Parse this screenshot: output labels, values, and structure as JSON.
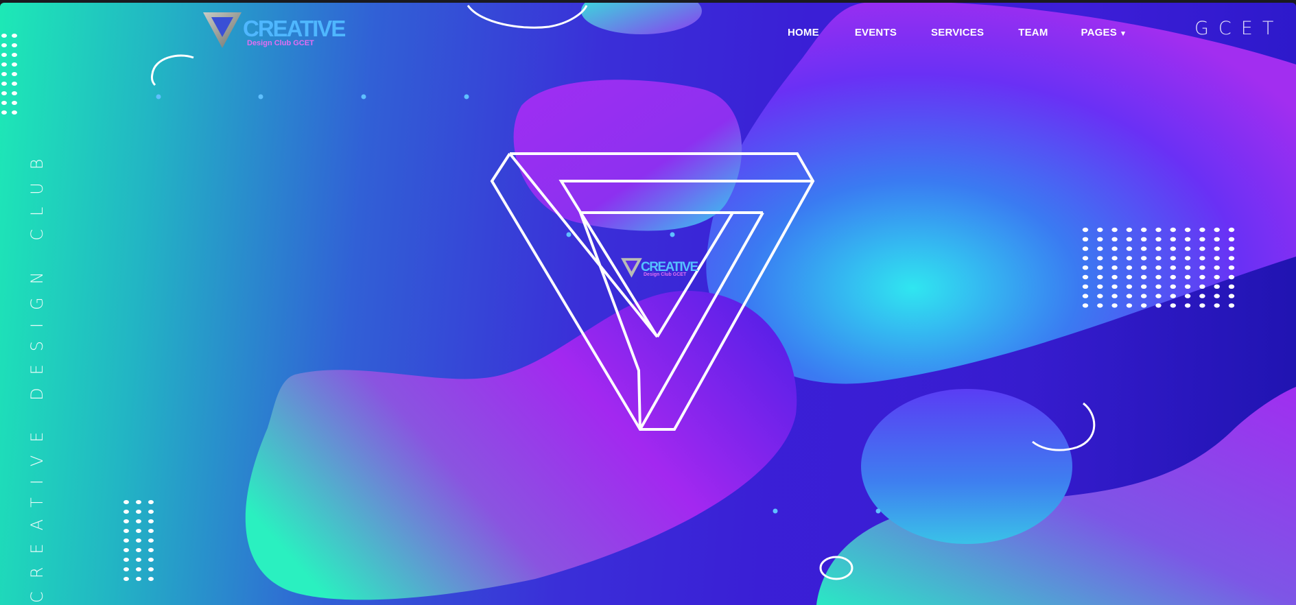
{
  "logo": {
    "word": "CREATIVE",
    "subtitle": "Design Club GCET"
  },
  "nav": {
    "items": [
      {
        "label": "HOME"
      },
      {
        "label": "EVENTS"
      },
      {
        "label": "SERVICES"
      },
      {
        "label": "TEAM"
      },
      {
        "label": "PAGES"
      }
    ],
    "pages_caret": "▾"
  },
  "brand_right": "GCET",
  "vertical_text": "CREATIVE DESIGN CLUB",
  "center_logo": {
    "word": "CREATIVE",
    "subtitle": "Design Club GCET"
  },
  "colors": {
    "teal": "#1de9b6",
    "blue": "#3a2fd8",
    "purple": "#a22ef0",
    "logo_blue": "#4fb7ff",
    "logo_pink": "#e36ef2"
  }
}
